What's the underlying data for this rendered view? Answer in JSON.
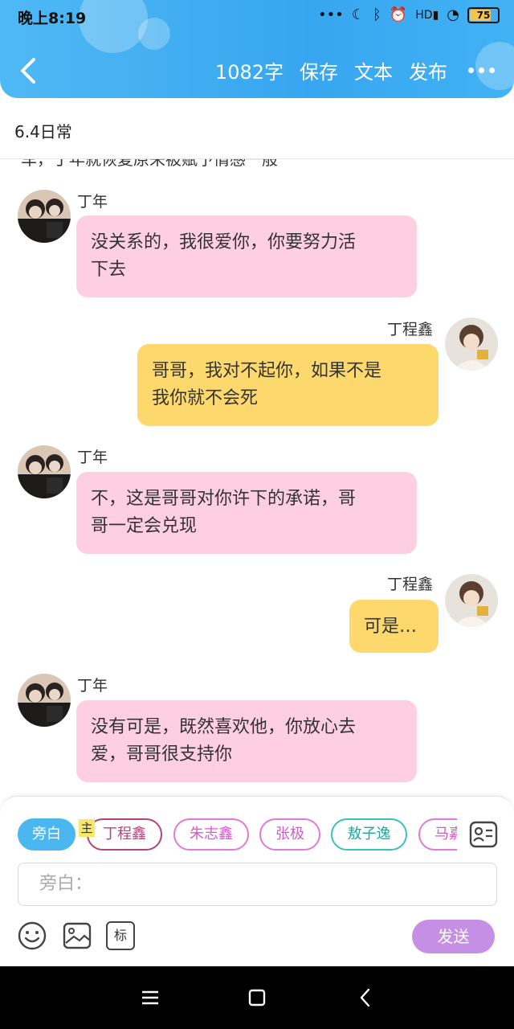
{
  "status": {
    "time": "晚上8:19",
    "battery": "75"
  },
  "header": {
    "word_count": "1082字",
    "save": "保存",
    "text": "文本",
    "publish": "发布"
  },
  "title": "6.4日常",
  "chat": {
    "cut_text": "车，丁年就恢复原来被赋予情感一般",
    "messages": [
      {
        "side": "left",
        "name": "丁年",
        "text_line1": "没关系的，我很爱你，你要努力活",
        "text_line2": "下去"
      },
      {
        "side": "right",
        "name": "丁程鑫",
        "text_line1": "哥哥，我对不起你，如果不是",
        "text_line2": "我你就不会死"
      },
      {
        "side": "left",
        "name": "丁年",
        "text_line1": "不，这是哥哥对你许下的承诺，哥",
        "text_line2": "哥一定会兑现"
      },
      {
        "side": "right",
        "name": "丁程鑫",
        "text_line1": "可是…",
        "text_line2": ""
      },
      {
        "side": "left",
        "name": "丁年",
        "text_line1": "没有可是，既然喜欢他，你放心去",
        "text_line2": "爱，哥哥很支持你"
      }
    ]
  },
  "input": {
    "chips": [
      "旁白",
      "丁程鑫",
      "朱志鑫",
      "张极",
      "敖子逸",
      "马嘉"
    ],
    "main_tag": "主",
    "placeholder": "旁白：",
    "tool_mark": "标",
    "send": "发送"
  },
  "colors": {
    "header": "#3aa8f1",
    "pink_bubble": "#fdcfe0",
    "yellow_bubble": "#fdd96d",
    "send": "#c58fe6"
  }
}
